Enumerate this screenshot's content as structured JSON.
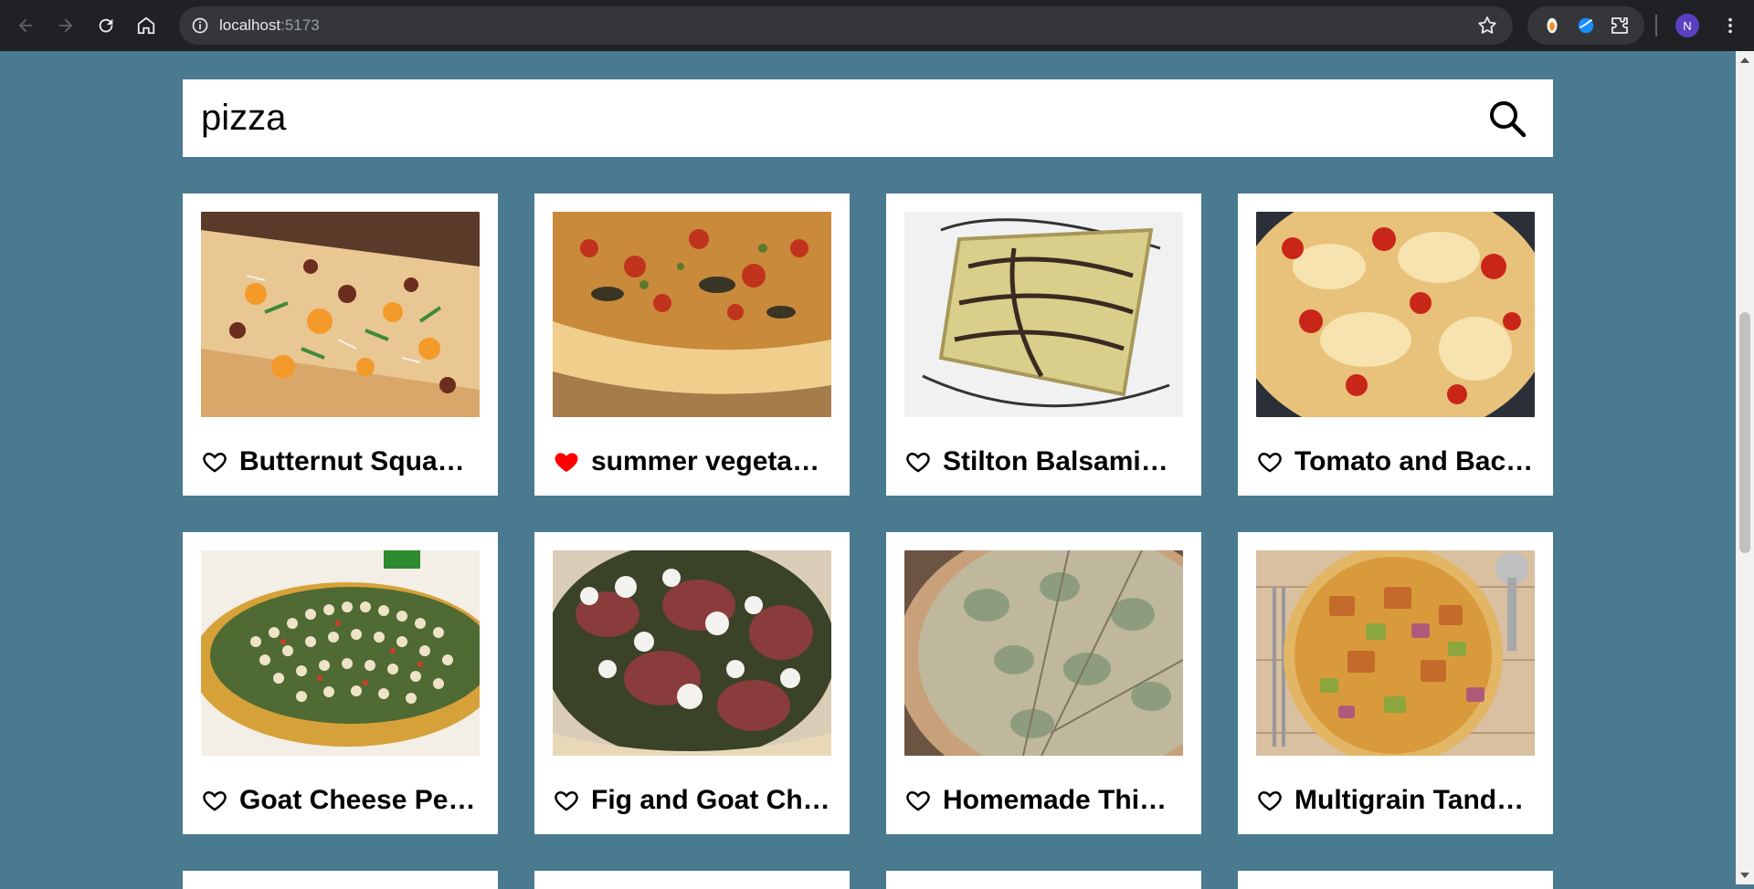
{
  "browser": {
    "url_host": "localhost",
    "url_port": ":5173",
    "profile_initial": "N"
  },
  "search": {
    "value": "pizza",
    "placeholder": ""
  },
  "recipes": [
    {
      "title": "Butternut Squash Pizza",
      "favorited": false
    },
    {
      "title": "summer vegetable pizza",
      "favorited": true
    },
    {
      "title": "Stilton Balsamic Pizza",
      "favorited": false
    },
    {
      "title": "Tomato and Bacon Pizza",
      "favorited": false
    },
    {
      "title": "Goat Cheese Pesto Pizza",
      "favorited": false
    },
    {
      "title": "Fig and Goat Cheese Pizza",
      "favorited": false
    },
    {
      "title": "Homemade Thin Crust Pizza",
      "favorited": false
    },
    {
      "title": "Multigrain Tandoori Pizza",
      "favorited": false
    }
  ],
  "colors": {
    "page_background": "#4a7a8f",
    "favorite_heart": "#ff0000"
  }
}
